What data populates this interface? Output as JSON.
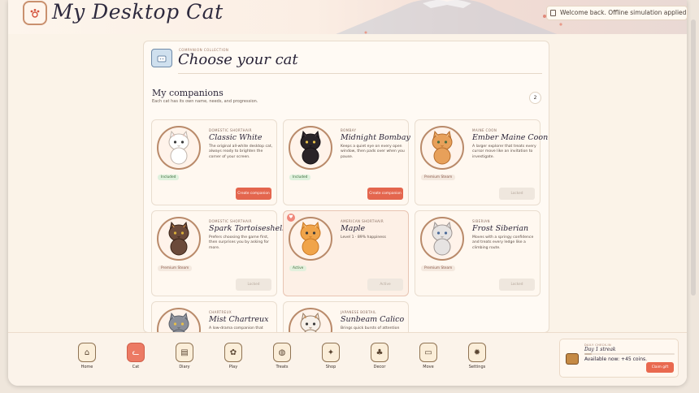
{
  "app": {
    "title": "My Desktop Cat",
    "logo_icon": "paw-icon"
  },
  "toast": {
    "text": "Welcome back. Offline simulation applied for th"
  },
  "panel": {
    "eyebrow": "COMPANION COLLECTION",
    "title": "Choose your cat",
    "section_title": "My companions",
    "section_subtitle": "Each cat has its own name, needs, and progression.",
    "count": "2"
  },
  "cats": [
    {
      "breed": "DOMESTIC SHORTHAIR",
      "name": "Classic White",
      "desc": "The original all-white desktop cat, always ready to brighten the corner of your screen.",
      "badge": "Included",
      "button": "Create companion"
    },
    {
      "breed": "BOMBAY",
      "name": "Midnight Bombay",
      "desc": "Keeps a quiet eye on every open window, then pads over when you pause.",
      "badge": "Included",
      "button": "Create companion"
    },
    {
      "breed": "MAINE COON",
      "name": "Ember Maine Coon",
      "desc": "A larger explorer that treats every cursor move like an invitation to investigate.",
      "badge": "Premium Steam",
      "button": "Locked"
    },
    {
      "breed": "DOMESTIC SHORTHAIR",
      "name": "Spark Tortoiseshell",
      "desc": "Prefers choosing the game first, then surprises you by asking for more.",
      "badge": "Premium Steam",
      "button": "Locked"
    },
    {
      "breed": "AMERICAN SHORTHAIR",
      "name": "Maple",
      "desc": "Level 1 · 89% happiness",
      "badge": "Active",
      "button": "Active",
      "favorite": "♥"
    },
    {
      "breed": "SIBERIAN",
      "name": "Frost Siberian",
      "desc": "Moves with a springy confidence and treats every ledge like a climbing route.",
      "badge": "Premium Steam",
      "button": "Locked"
    },
    {
      "breed": "CHARTREUX",
      "name": "Mist Chartreux",
      "desc": "A low-drama companion that",
      "badge": "",
      "button": ""
    },
    {
      "breed": "JAPANESE BOBTAIL",
      "name": "Sunbeam Calico",
      "desc": "Brings quick bursts of attention",
      "badge": "",
      "button": ""
    }
  ],
  "dock": [
    {
      "label": "Home",
      "icon": "home-icon",
      "glyph": "⌂"
    },
    {
      "label": "Cat",
      "icon": "cat-icon",
      "glyph": "ᓚ"
    },
    {
      "label": "Diary",
      "icon": "diary-icon",
      "glyph": "▤"
    },
    {
      "label": "Play",
      "icon": "play-icon",
      "glyph": "✿"
    },
    {
      "label": "Treats",
      "icon": "treats-icon",
      "glyph": "◍"
    },
    {
      "label": "Shop",
      "icon": "shop-icon",
      "glyph": "✦"
    },
    {
      "label": "Decor",
      "icon": "decor-icon",
      "glyph": "♣"
    },
    {
      "label": "Move",
      "icon": "move-icon",
      "glyph": "▭"
    },
    {
      "label": "Settings",
      "icon": "settings-icon",
      "glyph": "✹"
    }
  ],
  "streak": {
    "eyebrow": "DAILY CHECK-IN",
    "title": "Day 1 streak",
    "progress": 0.08,
    "available": "Available now: +45 coins.",
    "claim": "Claim gift"
  },
  "colors": {
    "accent": "#e4664e",
    "active_tile": "#ec7a64"
  }
}
